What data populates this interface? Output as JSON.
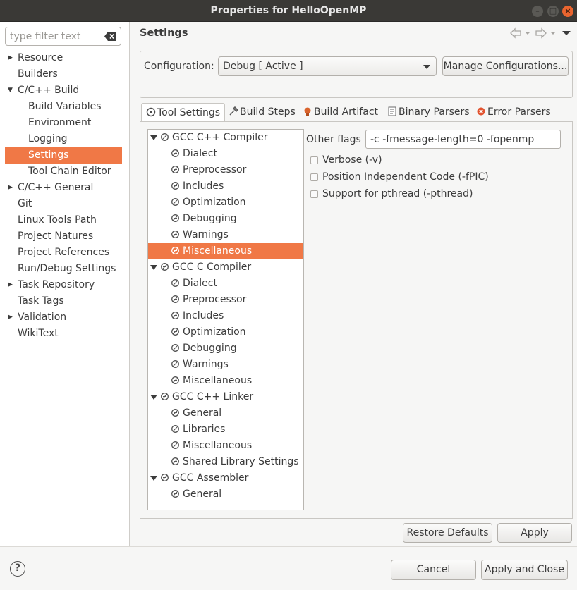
{
  "window": {
    "title": "Properties for HelloOpenMP",
    "controls": [
      "minimize-icon",
      "maximize-icon",
      "close-icon"
    ]
  },
  "filter": {
    "placeholder": "type filter text"
  },
  "nav": {
    "items": [
      {
        "label": "Resource",
        "arrow": "right"
      },
      {
        "label": "Builders"
      },
      {
        "label": "C/C++ Build",
        "arrow": "down"
      },
      {
        "label": "Build Variables"
      },
      {
        "label": "Environment"
      },
      {
        "label": "Logging"
      },
      {
        "label": "Settings",
        "selected": true
      },
      {
        "label": "Tool Chain Editor"
      },
      {
        "label": "C/C++ General",
        "arrow": "right"
      },
      {
        "label": "Git"
      },
      {
        "label": "Linux Tools Path"
      },
      {
        "label": "Project Natures"
      },
      {
        "label": "Project References"
      },
      {
        "label": "Run/Debug Settings"
      },
      {
        "label": "Task Repository",
        "arrow": "right"
      },
      {
        "label": "Task Tags"
      },
      {
        "label": "Validation",
        "arrow": "right"
      },
      {
        "label": "WikiText"
      }
    ]
  },
  "header": {
    "title": "Settings"
  },
  "config": {
    "label": "Configuration:",
    "value": "Debug  [ Active ]",
    "manage_label": "Manage Configurations..."
  },
  "tabs": [
    {
      "label": "Tool Settings",
      "icon": "tool-settings-icon",
      "active": true
    },
    {
      "label": "Build Steps",
      "icon": "build-steps-icon"
    },
    {
      "label": "Build Artifact",
      "icon": "build-artifact-icon"
    },
    {
      "label": "Binary Parsers",
      "icon": "binary-parsers-icon"
    },
    {
      "label": "Error Parsers",
      "icon": "error-parsers-icon"
    }
  ],
  "tree": [
    {
      "label": "GCC C++ Compiler",
      "level": 0
    },
    {
      "label": "Dialect",
      "level": 1
    },
    {
      "label": "Preprocessor",
      "level": 1
    },
    {
      "label": "Includes",
      "level": 1
    },
    {
      "label": "Optimization",
      "level": 1
    },
    {
      "label": "Debugging",
      "level": 1
    },
    {
      "label": "Warnings",
      "level": 1
    },
    {
      "label": "Miscellaneous",
      "level": 1,
      "selected": true
    },
    {
      "label": "GCC C Compiler",
      "level": 0
    },
    {
      "label": "Dialect",
      "level": 1
    },
    {
      "label": "Preprocessor",
      "level": 1
    },
    {
      "label": "Includes",
      "level": 1
    },
    {
      "label": "Optimization",
      "level": 1
    },
    {
      "label": "Debugging",
      "level": 1
    },
    {
      "label": "Warnings",
      "level": 1
    },
    {
      "label": "Miscellaneous",
      "level": 1
    },
    {
      "label": "GCC C++ Linker",
      "level": 0
    },
    {
      "label": "General",
      "level": 1
    },
    {
      "label": "Libraries",
      "level": 1
    },
    {
      "label": "Miscellaneous",
      "level": 1
    },
    {
      "label": "Shared Library Settings",
      "level": 1
    },
    {
      "label": "GCC Assembler",
      "level": 0
    },
    {
      "label": "General",
      "level": 1
    }
  ],
  "settings": {
    "other_flags_label": "Other flags",
    "other_flags_value": "-c -fmessage-length=0 -fopenmp",
    "checkboxes": [
      {
        "label": "Verbose (-v)",
        "checked": false
      },
      {
        "label": "Position Independent Code (-fPIC)",
        "checked": false
      },
      {
        "label": "Support for pthread (-pthread)",
        "checked": false
      }
    ]
  },
  "buttons": {
    "restore": "Restore Defaults",
    "apply": "Apply",
    "cancel": "Cancel",
    "apply_close": "Apply and Close",
    "help": "?"
  },
  "colors": {
    "accent": "#f07846",
    "titlebar": "#3a3936",
    "close_button": "#e9652f"
  }
}
